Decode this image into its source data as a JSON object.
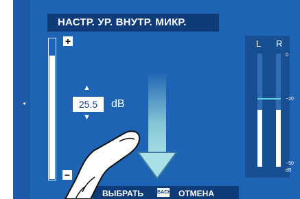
{
  "screen": {
    "title": "НАСТР. УР. ВНУТР. МИКР.",
    "left_arrow": "◂",
    "plus": "+",
    "minus": "−",
    "slider_level_fraction": 0.88
  },
  "value": {
    "up": "▲",
    "down": "▼",
    "number": "25.5",
    "unit": "dB"
  },
  "meter": {
    "left_label": "L",
    "right_label": "R",
    "scale": [
      "0",
      "−20",
      "−50",
      "dB"
    ],
    "left_level_fraction": 0.5,
    "right_level_fraction": 0.5
  },
  "bottom": {
    "select_label": "ВЫБРАТЬ",
    "back_icon_label": "BACK",
    "cancel_label": "ОТМЕНА"
  },
  "colors": {
    "background": "#1e64b4",
    "title_bar": "#0f3c78",
    "arrow": "#8fd0d8"
  },
  "icons": {
    "gesture": "hand-swipe-down-icon",
    "arrow": "arrow-down-icon"
  }
}
